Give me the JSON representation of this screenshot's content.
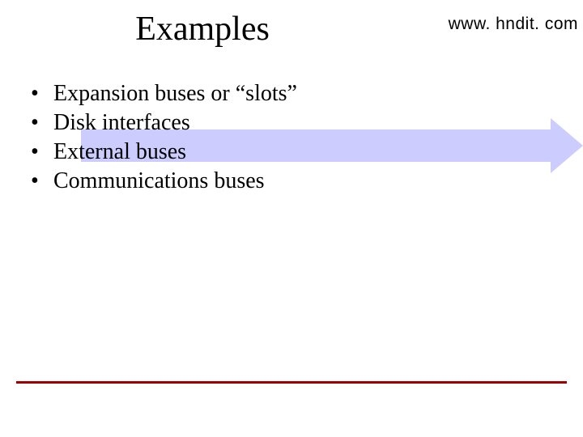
{
  "header": {
    "title": "Examples",
    "url": "www. hndit. com"
  },
  "bullets": [
    "Expansion buses or “slots”",
    "Disk interfaces",
    "External buses",
    "Communications buses"
  ],
  "accent_color": "#a00000",
  "arrow_color": "#ccccff"
}
